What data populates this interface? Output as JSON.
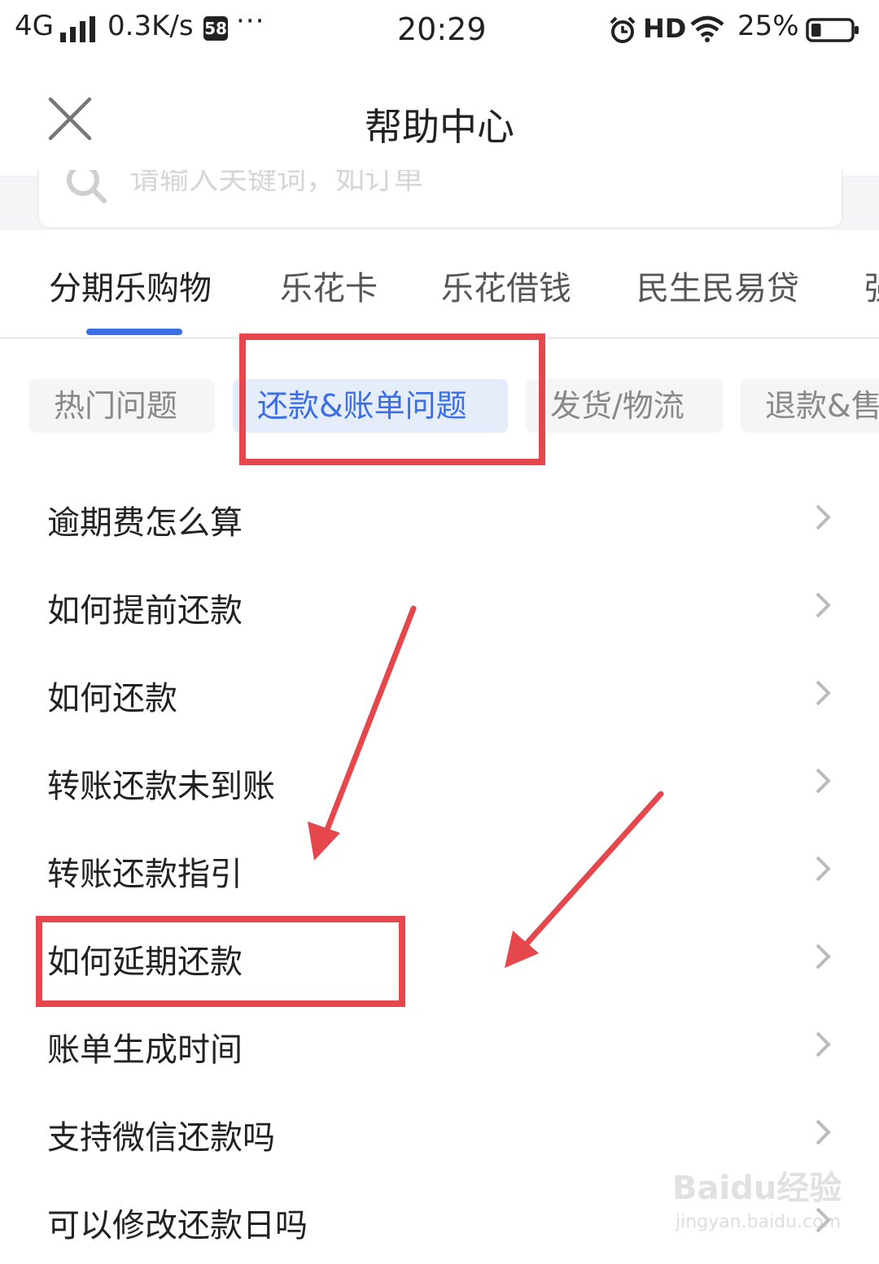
{
  "status_bar": {
    "network": "4G",
    "speed": "0.3K/s",
    "app_badge": "58",
    "more": "···",
    "time": "20:29",
    "hd": "HD",
    "battery_pct": "25%",
    "battery_level": 0.25
  },
  "header": {
    "title": "帮助中心"
  },
  "search": {
    "placeholder": "请输入关键词，如订单"
  },
  "main_tabs": [
    {
      "label": "分期乐购物",
      "active": true
    },
    {
      "label": "乐花卡",
      "active": false
    },
    {
      "label": "乐花借钱",
      "active": false
    },
    {
      "label": "民生民易贷",
      "active": false
    },
    {
      "label": "强",
      "active": false
    }
  ],
  "sub_tabs": [
    {
      "label": "热门问题",
      "active": false
    },
    {
      "label": "还款&账单问题",
      "active": true
    },
    {
      "label": "发货/物流",
      "active": false
    },
    {
      "label": "退款&售",
      "active": false
    }
  ],
  "faq_items": [
    {
      "label": "逾期费怎么算"
    },
    {
      "label": "如何提前还款"
    },
    {
      "label": "如何还款"
    },
    {
      "label": "转账还款未到账"
    },
    {
      "label": "转账还款指引"
    },
    {
      "label": "如何延期还款"
    },
    {
      "label": "账单生成时间"
    },
    {
      "label": "支持微信还款吗"
    },
    {
      "label": "可以修改还款日吗"
    }
  ],
  "watermark": {
    "brand": "Baidu经验",
    "url": "jingyan.baidu.com"
  },
  "colors": {
    "accent": "#3c6ee8",
    "annotation": "#e5474c"
  }
}
